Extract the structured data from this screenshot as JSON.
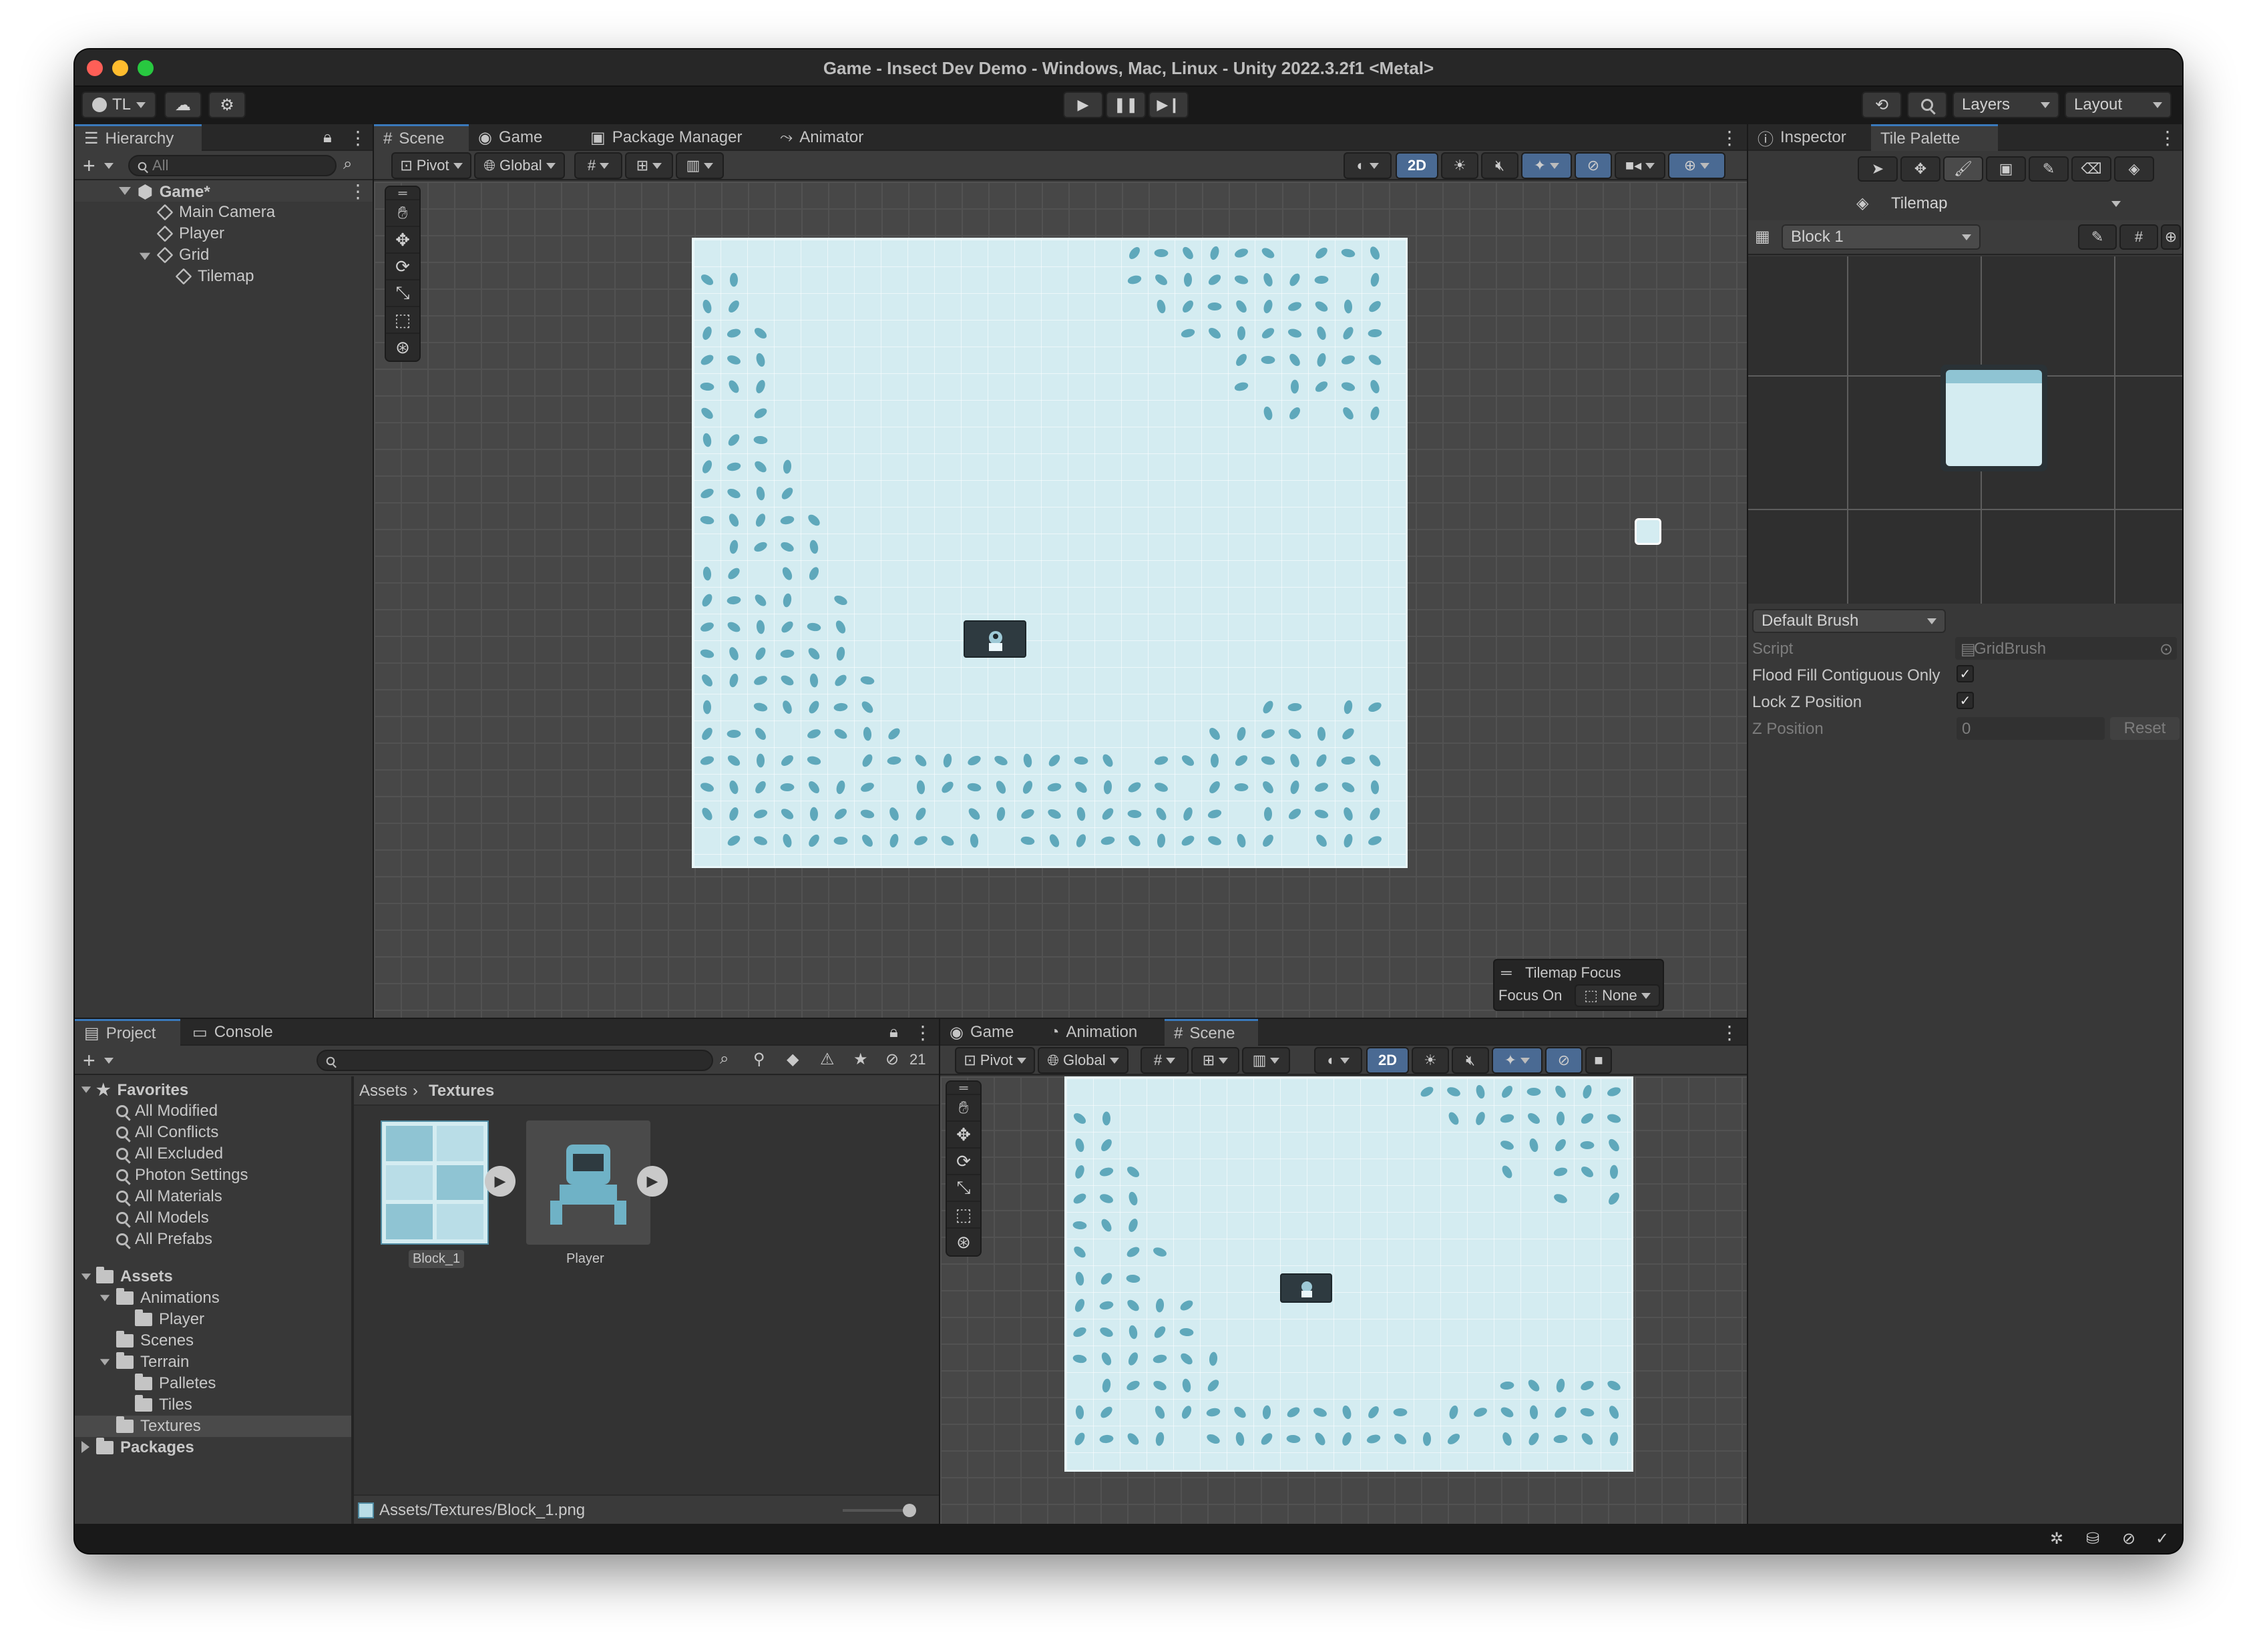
{
  "window": {
    "title": "Game - Insect Dev Demo - Windows, Mac, Linux - Unity 2022.3.2f1 <Metal>"
  },
  "toolbar": {
    "account": "TL",
    "layers": "Layers",
    "layout": "Layout"
  },
  "hierarchy": {
    "tab": "Hierarchy",
    "search_placeholder": "All",
    "scene": "Game*",
    "items": [
      {
        "label": "Main Camera"
      },
      {
        "label": "Player"
      },
      {
        "label": "Grid"
      },
      {
        "label": "Tilemap"
      }
    ]
  },
  "scene_tabs": [
    {
      "label": "Scene"
    },
    {
      "label": "Game"
    },
    {
      "label": "Package Manager"
    },
    {
      "label": "Animator"
    }
  ],
  "scene_toolbar": {
    "pivot": "Pivot",
    "global": "Global",
    "mode_2d": "2D"
  },
  "tilemap_focus": {
    "title": "Tilemap Focus",
    "focus_label": "Focus On",
    "focus_value": "None"
  },
  "inspector": {
    "tabs": [
      {
        "label": "Inspector"
      },
      {
        "label": "Tile Palette"
      }
    ],
    "active_tilemap": "Tilemap",
    "palette": "Block 1",
    "brush": "Default Brush",
    "fields": {
      "script_label": "Script",
      "script_value": "GridBrush",
      "flood_label": "Flood Fill Contiguous Only",
      "flood_checked": true,
      "lockz_label": "Lock Z Position",
      "lockz_checked": true,
      "zpos_label": "Z Position",
      "zpos_value": "0",
      "reset_label": "Reset"
    }
  },
  "project": {
    "tabs": [
      {
        "label": "Project"
      },
      {
        "label": "Console"
      }
    ],
    "hidden_count": "21",
    "favorites_label": "Favorites",
    "favorites": [
      {
        "label": "All Modified"
      },
      {
        "label": "All Conflicts"
      },
      {
        "label": "All Excluded"
      },
      {
        "label": "Photon Settings"
      },
      {
        "label": "All Materials"
      },
      {
        "label": "All Models"
      },
      {
        "label": "All Prefabs"
      }
    ],
    "assets_label": "Assets",
    "tree": [
      {
        "label": "Animations"
      },
      {
        "label": "Player"
      },
      {
        "label": "Scenes"
      },
      {
        "label": "Terrain"
      },
      {
        "label": "Palletes"
      },
      {
        "label": "Tiles"
      },
      {
        "label": "Textures"
      }
    ],
    "packages_label": "Packages",
    "breadcrumb": {
      "root": "Assets",
      "current": "Textures"
    },
    "assets_grid": [
      {
        "label": "Block_1"
      },
      {
        "label": "Player"
      }
    ],
    "status_path": "Assets/Textures/Block_1.png"
  },
  "bottom_tabs": [
    {
      "label": "Game"
    },
    {
      "label": "Animation"
    },
    {
      "label": "Scene"
    }
  ],
  "colors": {
    "accent": "#3a79bb",
    "tile": "#d4ecf1",
    "leaf": "#5fa8bb",
    "editor_bg": "#383838"
  }
}
